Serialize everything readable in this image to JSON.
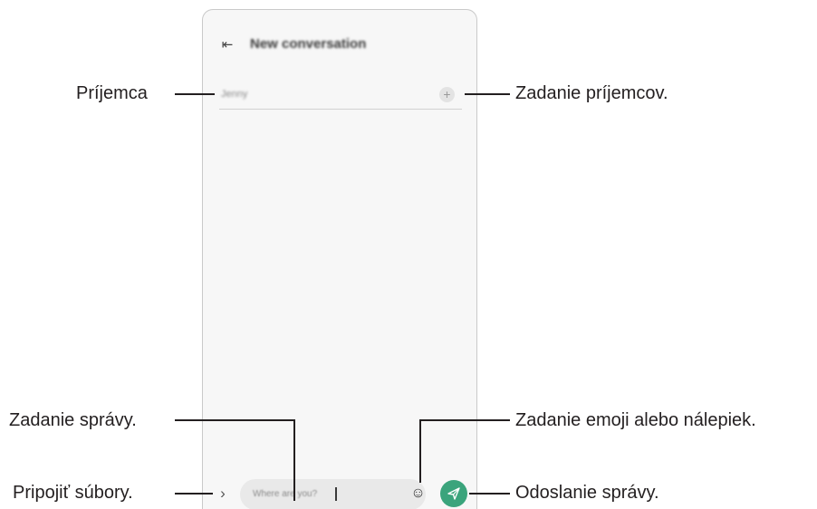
{
  "screen": {
    "title": "New conversation",
    "recipient_name": "Jenny",
    "message_text": "Where are you?",
    "accent_color": "#3ba47c",
    "icons": {
      "back": "back-arrow-icon",
      "add_recipient": "plus-icon",
      "attach": "chevron-right-icon",
      "emoji": "smiley-icon",
      "send": "paper-plane-icon"
    }
  },
  "callouts": {
    "recipient": "Príjemca",
    "enter_recipients": "Zadanie príjemcov.",
    "enter_message": "Zadanie správy.",
    "emoji_stickers": "Zadanie emoji alebo nálepiek.",
    "attach_files": "Pripojiť súbory.",
    "send_message": "Odoslanie správy."
  }
}
